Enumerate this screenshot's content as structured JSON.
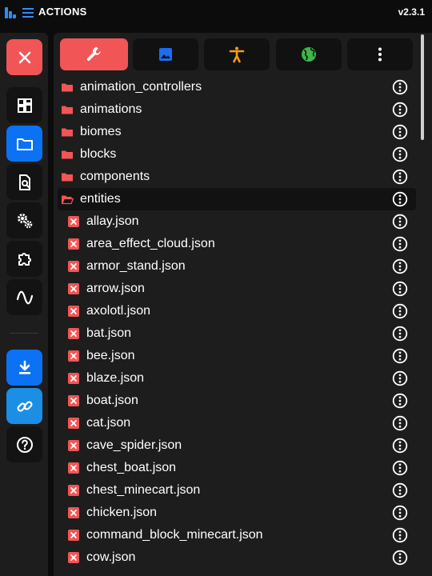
{
  "app": {
    "title": "ACTIONS",
    "version": "v2.3.1"
  },
  "colors": {
    "accent_red": "#f25555",
    "accent_blue": "#0c72f3",
    "accent_cyan": "#1b8ee6",
    "tab_icon_blue": "#1e6cf0",
    "tab_icon_orange": "#f59a1a",
    "tab_icon_green": "#3cb54a"
  },
  "sidebar": {
    "buttons": [
      {
        "icon": "close-icon",
        "name": "close-button"
      },
      {
        "icon": "dashboard-icon",
        "name": "dashboard-button"
      },
      {
        "icon": "folder-icon",
        "name": "explorer-button",
        "active": true
      },
      {
        "icon": "file-search-icon",
        "name": "file-search-button"
      },
      {
        "icon": "settings-gears-icon",
        "name": "settings-button"
      },
      {
        "icon": "puzzle-icon",
        "name": "extensions-button"
      },
      {
        "icon": "waveform-icon",
        "name": "wave-button"
      },
      {
        "icon": "download-icon",
        "name": "download-button"
      },
      {
        "icon": "link-icon",
        "name": "link-button"
      },
      {
        "icon": "help-icon",
        "name": "help-button"
      }
    ]
  },
  "tabs": [
    {
      "icon": "wrench-icon",
      "active": true
    },
    {
      "icon": "image-icon"
    },
    {
      "icon": "accessibility-icon"
    },
    {
      "icon": "globe-icon"
    },
    {
      "icon": "more-vertical-icon"
    }
  ],
  "explorer": {
    "folders": [
      {
        "label": "animation_controllers"
      },
      {
        "label": "animations"
      },
      {
        "label": "biomes"
      },
      {
        "label": "blocks"
      },
      {
        "label": "components"
      },
      {
        "label": "entities",
        "open": true
      }
    ],
    "files": [
      {
        "label": "allay.json"
      },
      {
        "label": "area_effect_cloud.json"
      },
      {
        "label": "armor_stand.json"
      },
      {
        "label": "arrow.json"
      },
      {
        "label": "axolotl.json"
      },
      {
        "label": "bat.json"
      },
      {
        "label": "bee.json"
      },
      {
        "label": "blaze.json"
      },
      {
        "label": "boat.json"
      },
      {
        "label": "cat.json"
      },
      {
        "label": "cave_spider.json"
      },
      {
        "label": "chest_boat.json"
      },
      {
        "label": "chest_minecart.json"
      },
      {
        "label": "chicken.json"
      },
      {
        "label": "command_block_minecart.json"
      },
      {
        "label": "cow.json"
      }
    ]
  }
}
